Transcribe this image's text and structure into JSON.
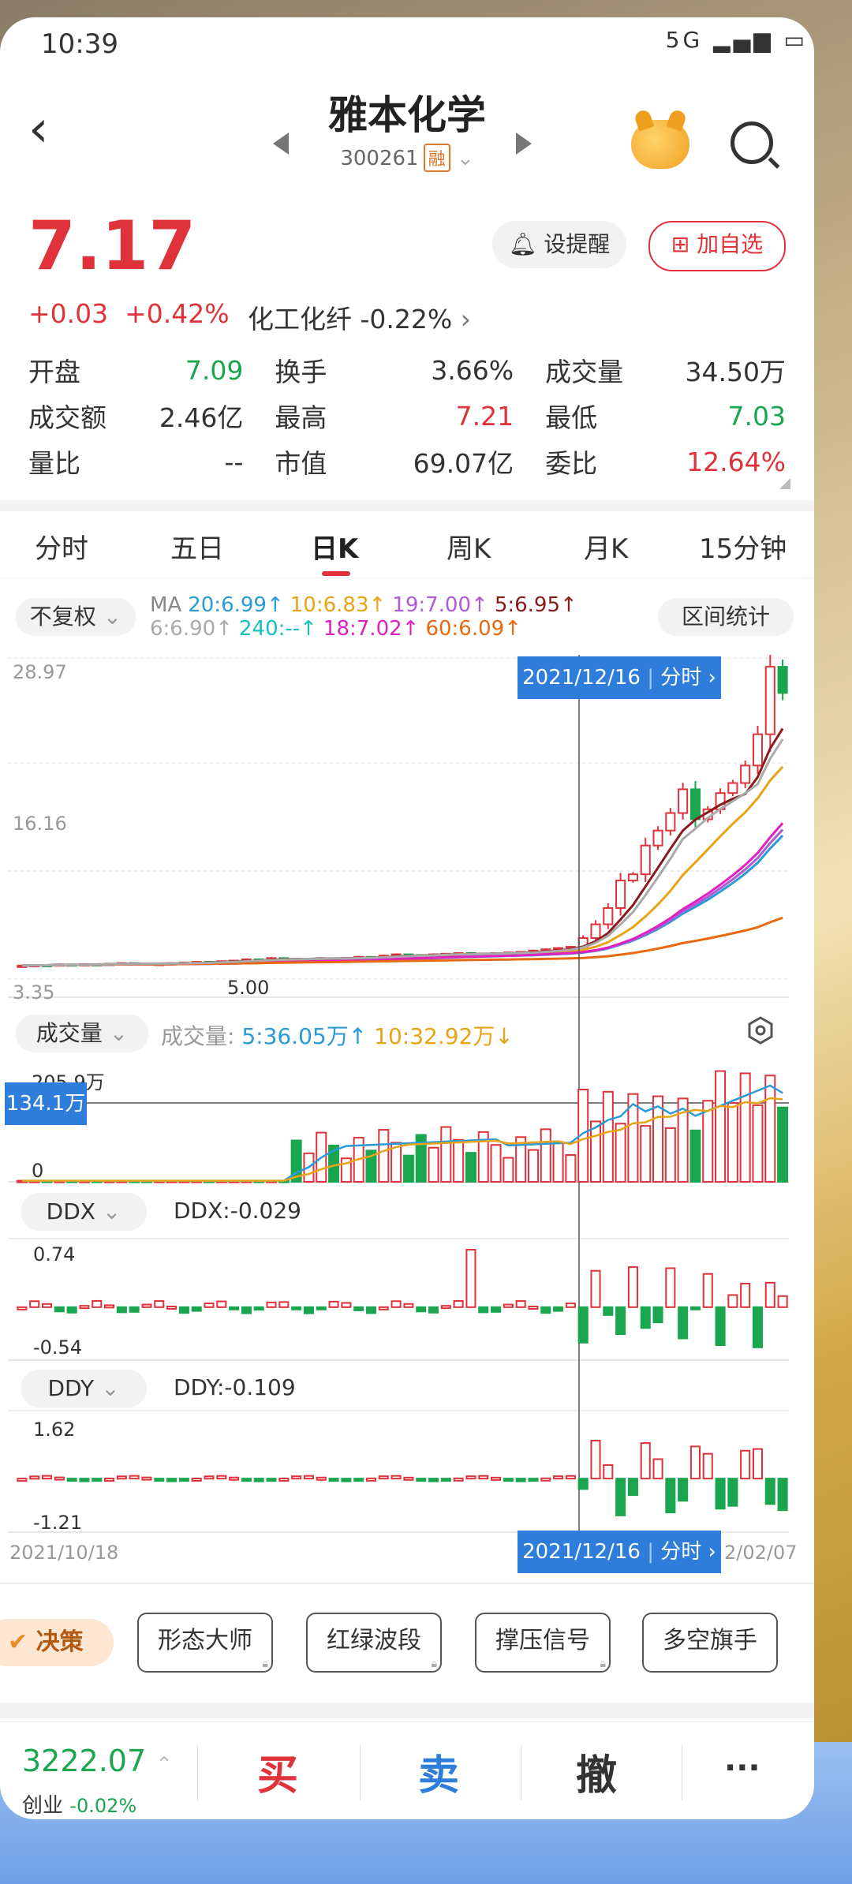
{
  "status": {
    "time": "10:39",
    "icons": "5G ▂▄▆ ▭"
  },
  "header": {
    "title": "雅本化学",
    "code": "300261",
    "badge": "融"
  },
  "quote": {
    "price": "7.17",
    "change": "+0.03",
    "change_pct": "+0.42%",
    "sector": "化工化纤 -0.22%",
    "remind_label": "设提醒",
    "add_label": "加自选"
  },
  "stats": [
    [
      {
        "k": "开盘",
        "v": "7.09",
        "c": "green"
      },
      {
        "k": "换手",
        "v": "3.66%",
        "c": ""
      },
      {
        "k": "成交量",
        "v": "34.50万",
        "c": ""
      }
    ],
    [
      {
        "k": "成交额",
        "v": "2.46亿",
        "c": ""
      },
      {
        "k": "最高",
        "v": "7.21",
        "c": "red"
      },
      {
        "k": "最低",
        "v": "7.03",
        "c": "green"
      }
    ],
    [
      {
        "k": "量比",
        "v": "--",
        "c": ""
      },
      {
        "k": "市值",
        "v": "69.07亿",
        "c": ""
      },
      {
        "k": "委比",
        "v": "12.64%",
        "c": "red"
      }
    ]
  ],
  "tabs": [
    "分时",
    "五日",
    "日K",
    "周K",
    "月K",
    "15分钟"
  ],
  "active_tab": "日K",
  "kline": {
    "adjust_label": "不复权",
    "range_label": "区间统计",
    "ma_row1": [
      {
        "t": "MA",
        "c": "#888"
      },
      {
        "t": "20:6.99↑",
        "c": "#2a9bd8"
      },
      {
        "t": "10:6.83↑",
        "c": "#e8a317"
      },
      {
        "t": "19:7.00↑",
        "c": "#b05ad8"
      },
      {
        "t": "5:6.95↑",
        "c": "#8b1a1a"
      }
    ],
    "ma_row2": [
      {
        "t": "6:6.90↑",
        "c": "#aaa"
      },
      {
        "t": "240:--↑",
        "c": "#16c0c0"
      },
      {
        "t": "18:7.02↑",
        "c": "#e020c0"
      },
      {
        "t": "60:6.09↑",
        "c": "#e86a10"
      }
    ],
    "y_max": "28.97",
    "y_mid": "16.16",
    "y_min": "3.35",
    "low_marker": "5.00",
    "cursor_date": "2021/12/16",
    "cursor_link": "分时",
    "start_date": "2021/10/18",
    "end_date": "2/02/07"
  },
  "volume": {
    "label": "成交量",
    "text_prefix": "成交量:",
    "ma5": "5:36.05万↑",
    "ma10": "10:32.92万↓",
    "y_max": "205.9万",
    "y_min": "0",
    "cursor_value": "134.1万"
  },
  "ddx": {
    "label": "DDX",
    "value_text": "DDX:-0.029",
    "y_max": "0.74",
    "y_min": "-0.54"
  },
  "ddy": {
    "label": "DDY",
    "value_text": "DDY:-0.109",
    "y_max": "1.62",
    "y_min": "-1.21"
  },
  "tools": {
    "juece": "决策",
    "items": [
      "形态大师",
      "红绿波段",
      "撑压信号",
      "多空旗手"
    ]
  },
  "bottom": {
    "index_value": "3222.07",
    "index_name": "创业",
    "index_change": "-0.02%",
    "buy": "买",
    "sell": "卖",
    "cancel": "撤",
    "more": "···"
  },
  "colors": {
    "up": "#e0323a",
    "down": "#1aa64f",
    "cursor_bg": "#2f7ddb"
  },
  "chart_data": {
    "type": "candlestick",
    "title": "",
    "x_range": [
      "2021/10/18",
      "2022/02/07"
    ],
    "ylim": [
      3.35,
      28.97
    ],
    "closes": [
      5.0,
      5.05,
      5.02,
      5.1,
      5.08,
      5.12,
      5.1,
      5.15,
      5.2,
      5.18,
      5.1,
      5.15,
      5.2,
      5.25,
      5.3,
      5.28,
      5.35,
      5.4,
      5.5,
      5.45,
      5.6,
      5.55,
      5.5,
      5.55,
      5.6,
      5.58,
      5.62,
      5.7,
      5.65,
      5.8,
      5.9,
      5.85,
      5.8,
      5.9,
      5.95,
      6.0,
      5.9,
      5.95,
      6.0,
      6.05,
      6.1,
      6.2,
      6.3,
      6.4,
      6.5,
      7.2,
      8.3,
      9.6,
      11.8,
      12.3,
      14.6,
      15.8,
      17.2,
      19.1,
      16.7,
      17.5,
      18.8,
      19.6,
      21.0,
      23.5,
      28.9,
      26.8
    ],
    "volume_ylim": [
      0,
      205.9
    ],
    "ddx_ylim": [
      -0.54,
      0.74
    ],
    "ddy_ylim": [
      -1.21,
      1.62
    ]
  }
}
